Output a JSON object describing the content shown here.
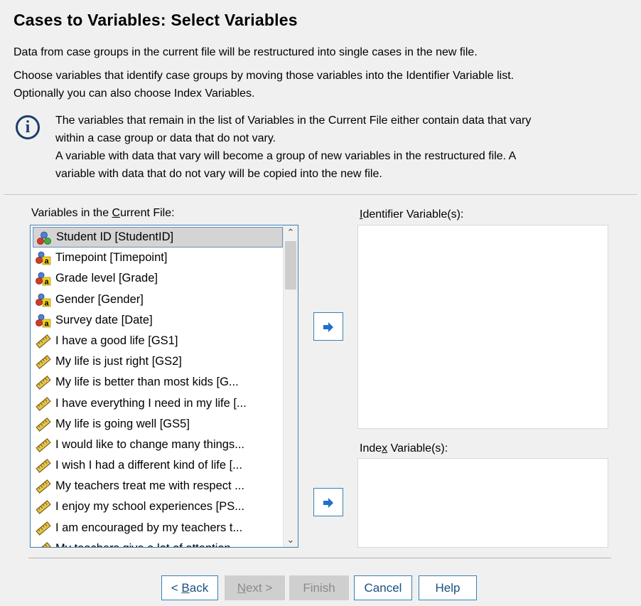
{
  "page": {
    "title": "Cases to Variables: Select Variables",
    "intro": "Data from case groups in the current file will be restructured into single cases in the new file.",
    "instruction_line1": "Choose variables that identify case groups by moving those variables into the Identifier Variable list.",
    "instruction_line2": "Optionally you can also choose Index Variables."
  },
  "info": {
    "icon": "info-icon",
    "line1": "The variables that remain in the list of Variables in the Current File either contain data that vary",
    "line2": "within a case group or data that do not vary.",
    "line3": "A variable with data that vary will become a group of new variables in the restructured file.  A",
    "line4": "variable with data that do not vary will be copied into the new file."
  },
  "source": {
    "label_pre": "Variables in the ",
    "label_u": "C",
    "label_post": "urrent File:",
    "items": [
      {
        "label": "Student ID [StudentID]",
        "icon": "nominal-icon",
        "selected": true
      },
      {
        "label": "Timepoint [Timepoint]",
        "icon": "nominal-string-icon"
      },
      {
        "label": "Grade level [Grade]",
        "icon": "nominal-string-icon"
      },
      {
        "label": "Gender [Gender]",
        "icon": "nominal-string-icon"
      },
      {
        "label": "Survey date [Date]",
        "icon": "nominal-string-icon"
      },
      {
        "label": "I have a good life [GS1]",
        "icon": "scale-icon"
      },
      {
        "label": "My life is just right [GS2]",
        "icon": "scale-icon"
      },
      {
        "label": "My life is better than most kids [G...",
        "icon": "scale-icon"
      },
      {
        "label": "I have everything I need in my life [...",
        "icon": "scale-icon"
      },
      {
        "label": "My life is going well [GS5]",
        "icon": "scale-icon"
      },
      {
        "label": "I would like to change many things...",
        "icon": "scale-icon"
      },
      {
        "label": "I wish I had a different kind of life [...",
        "icon": "scale-icon"
      },
      {
        "label": "My teachers treat me with respect ...",
        "icon": "scale-icon"
      },
      {
        "label": "I enjoy my school experiences [PS...",
        "icon": "scale-icon"
      },
      {
        "label": "I am encouraged by my teachers t...",
        "icon": "scale-icon"
      },
      {
        "label": "My teachers give a lot of attention",
        "icon": "scale-icon"
      }
    ]
  },
  "identifier": {
    "label_pre": "",
    "label_u": "I",
    "label_post": "dentifier Variable(s):"
  },
  "index": {
    "label_pre": "Inde",
    "label_u": "x",
    "label_post": " Variable(s):"
  },
  "buttons": {
    "back_pre": "< ",
    "back_u": "B",
    "back_post": "ack",
    "next_u": "N",
    "next_post": "ext >",
    "finish": "Finish",
    "cancel": "Cancel",
    "help": "Help"
  },
  "colors": {
    "focus_border": "#3c7fb1",
    "arrow": "#1f6fd0",
    "info": "#1e3d6b"
  }
}
